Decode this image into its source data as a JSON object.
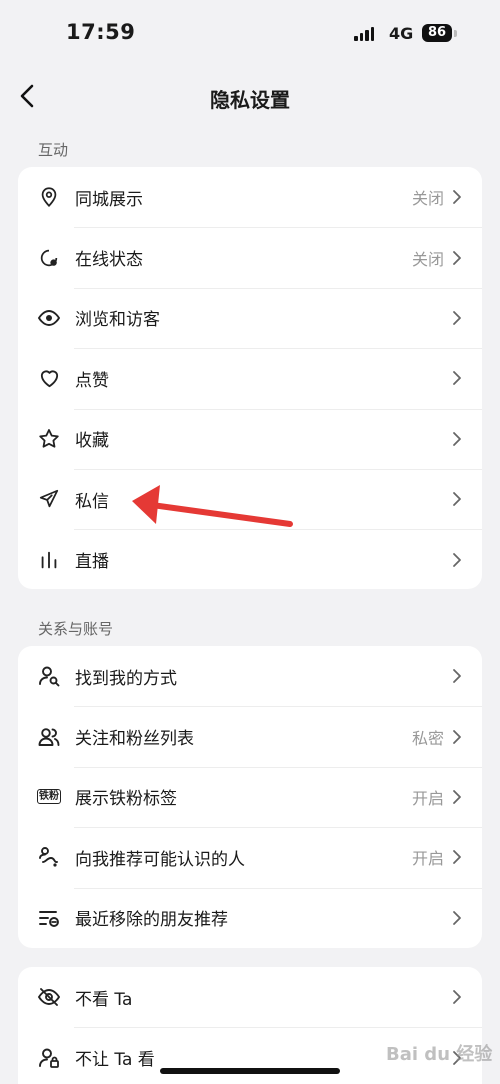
{
  "status_bar": {
    "time": "17:59",
    "network": "4G",
    "battery": "86"
  },
  "nav": {
    "title": "隐私设置",
    "back_icon": "chevron-left-icon"
  },
  "sections": [
    {
      "label": "互动",
      "items": [
        {
          "label": "同城展示",
          "value": "关闭",
          "icon": "location-pin-icon"
        },
        {
          "label": "在线状态",
          "value": "关闭",
          "icon": "online-status-icon"
        },
        {
          "label": "浏览和访客",
          "value": "",
          "icon": "eye-icon"
        },
        {
          "label": "点赞",
          "value": "",
          "icon": "heart-icon"
        },
        {
          "label": "收藏",
          "value": "",
          "icon": "star-icon"
        },
        {
          "label": "私信",
          "value": "",
          "icon": "paper-plane-icon"
        },
        {
          "label": "直播",
          "value": "",
          "icon": "live-bars-icon"
        }
      ]
    },
    {
      "label": "关系与账号",
      "items": [
        {
          "label": "找到我的方式",
          "value": "",
          "icon": "user-search-icon"
        },
        {
          "label": "关注和粉丝列表",
          "value": "私密",
          "icon": "users-icon"
        },
        {
          "label": "展示铁粉标签",
          "value": "开启",
          "icon": "fan-tag-icon",
          "tag_text": "铁粉"
        },
        {
          "label": "向我推荐可能认识的人",
          "value": "开启",
          "icon": "recommend-icon"
        },
        {
          "label": "最近移除的朋友推荐",
          "value": "",
          "icon": "removed-list-icon"
        }
      ]
    },
    {
      "label": "",
      "items": [
        {
          "label": "不看 Ta",
          "value": "",
          "icon": "eye-off-icon"
        },
        {
          "label": "不让 Ta 看",
          "value": "",
          "icon": "user-lock-icon"
        }
      ]
    }
  ],
  "annotation": {
    "arrow_color": "#e53935",
    "arrow_icon": "red-arrow-icon"
  },
  "watermark": {
    "text": "Bai du 经验"
  }
}
